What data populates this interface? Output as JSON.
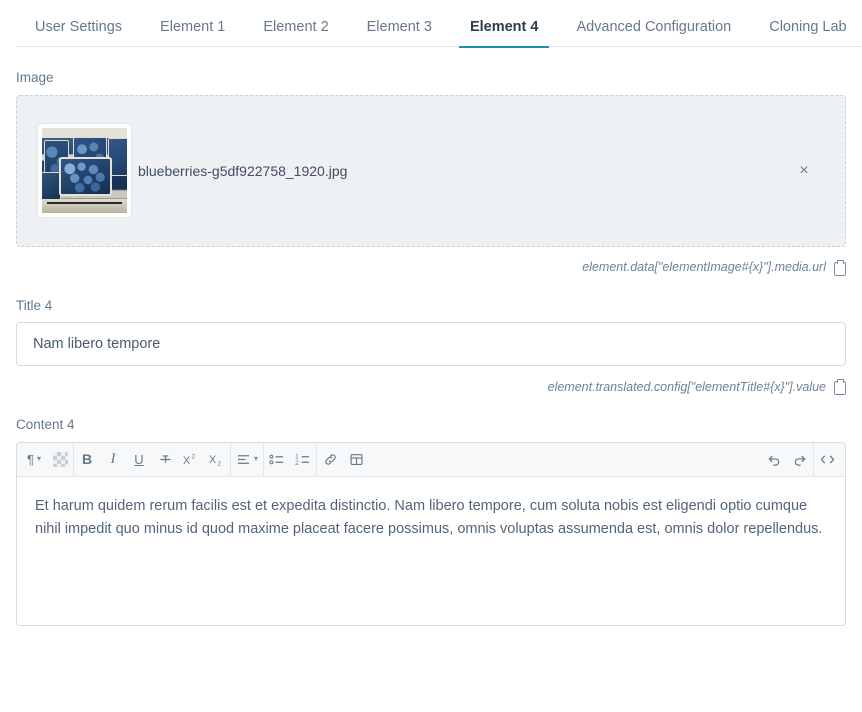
{
  "tabs": [
    {
      "label": "User Settings",
      "active": false
    },
    {
      "label": "Element 1",
      "active": false
    },
    {
      "label": "Element 2",
      "active": false
    },
    {
      "label": "Element 3",
      "active": false
    },
    {
      "label": "Element 4",
      "active": true
    },
    {
      "label": "Advanced Configuration",
      "active": false
    },
    {
      "label": "Cloning Lab",
      "active": false
    }
  ],
  "accent_color": "#1f8fa8",
  "image_field": {
    "label": "Image",
    "file_name": "blueberries-g5df922758_1920.jpg",
    "remove_label": "×",
    "thumbnail_alt": "blueberries in punnets",
    "path_hint": "element.data[\"elementImage#{x}\"].media.url",
    "copy_icon": "clipboard-icon"
  },
  "title_field": {
    "label": "Title 4",
    "value": "Nam libero tempore",
    "placeholder": "",
    "path_hint": "element.translated.config[\"elementTitle#{x}\"].value",
    "copy_icon": "clipboard-icon"
  },
  "content_field": {
    "label": "Content 4",
    "body": "Et harum quidem rerum facilis est et expedita distinctio. Nam libero tempore, cum soluta nobis est eligendi optio cumque nihil impedit quo minus id quod maxime placeat facere possimus, omnis voluptas assumenda est, omnis dolor repellendus.",
    "toolbar": {
      "paragraph_format": "¶",
      "chevron": "▾",
      "bold": "B",
      "italic": "I",
      "underline": "U",
      "strikethrough": "strikethrough-icon",
      "superscript_base": "X",
      "superscript_sup": "2",
      "subscript_base": "X",
      "subscript_sub": "2",
      "align": "align-icon",
      "bullet_list": "bullet-list-icon",
      "numbered_list": "numbered-list-icon",
      "link": "link-icon",
      "table": "table-icon",
      "undo": "undo-icon",
      "redo": "redo-icon",
      "source_code": "code-view-icon"
    }
  }
}
